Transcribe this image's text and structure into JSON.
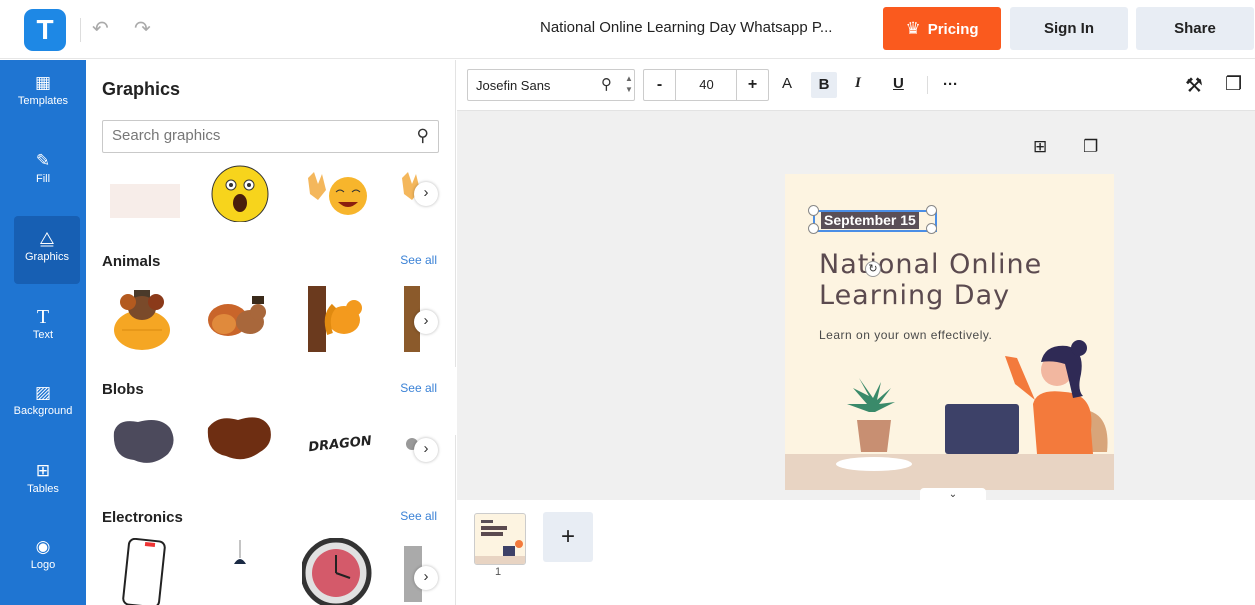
{
  "app": {
    "logo_letter": "T",
    "document_title": "National Online Learning Day Whatsapp P...",
    "undo_icon": "↶",
    "redo_icon": "↷"
  },
  "header": {
    "pricing_label": "Pricing",
    "pricing_icon": "♛",
    "signin_label": "Sign In",
    "share_label": "Share",
    "accent_color": "#fa5a1e"
  },
  "rail": {
    "items": [
      {
        "label": "Templates",
        "icon": "▦"
      },
      {
        "label": "Fill",
        "icon": "✎"
      },
      {
        "label": "Graphics",
        "icon": "⧋"
      },
      {
        "label": "Text",
        "icon": "T"
      },
      {
        "label": "Background",
        "icon": "▨"
      },
      {
        "label": "Tables",
        "icon": "⊞"
      },
      {
        "label": "Logo",
        "icon": "◉"
      }
    ],
    "active": "Graphics",
    "color": "#1f75d2"
  },
  "panel": {
    "title": "Graphics",
    "search_placeholder": "Search graphics",
    "see_all": "See all",
    "categories": [
      {
        "title": "Animals"
      },
      {
        "title": "Blobs"
      },
      {
        "title": "Electronics"
      }
    ],
    "dragon_text": "DRAGON"
  },
  "toolbar": {
    "font_name": "Josefin Sans",
    "font_size": "40",
    "minus": "-",
    "plus": "+",
    "text_color": "A",
    "bold": "B",
    "italic": "I",
    "underline": "U",
    "more": "···"
  },
  "design": {
    "date": "September 15",
    "heading": "National Online Learning Day",
    "subline": "Learn on your own effectively."
  },
  "pages": {
    "current_page": "1",
    "add_label": "+",
    "page_tab_icon": "⌄"
  }
}
